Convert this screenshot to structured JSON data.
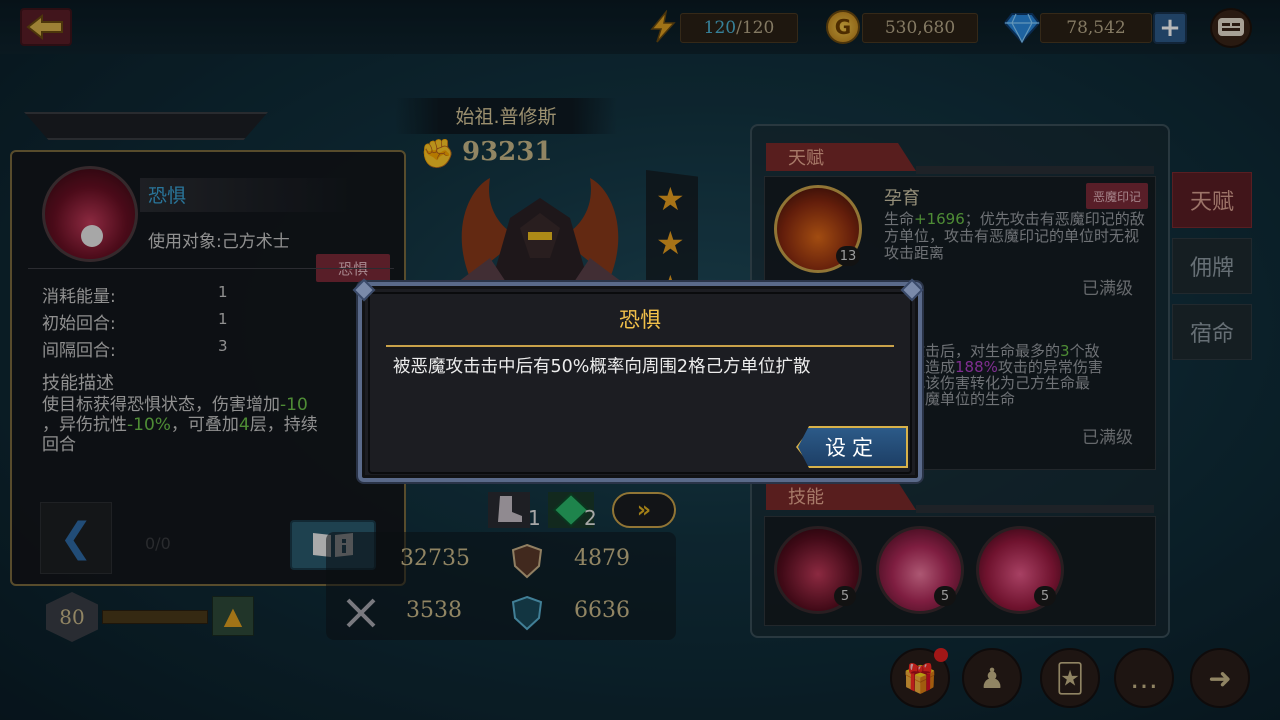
{
  "topbar": {
    "energy_current": "120",
    "energy_max": "/120",
    "gold": "530,680",
    "gems": "78,542",
    "gold_icon_glyph": "G",
    "plus_glyph": "+"
  },
  "skill_panel": {
    "name": "恐惧",
    "target": "使用对象:己方术士",
    "tag": "恐惧",
    "stats": [
      {
        "label": "消耗能量:",
        "value": "1"
      },
      {
        "label": "初始回合:",
        "value": "1"
      },
      {
        "label": "间隔回合:",
        "value": "3"
      }
    ],
    "desc_title": "技能描述",
    "desc_part1": "使目标获得恐惧状态，伤害增加",
    "desc_green1": "-10",
    "desc_part2": "，异伤抗性",
    "desc_green2": "-10%",
    "desc_part3": "，可叠加",
    "desc_green3": "4",
    "desc_part4": "层，持续",
    "desc_part5": "回合",
    "page_counter": "0/0",
    "level": "80"
  },
  "hero": {
    "name": "始祖.普修斯",
    "power": "93231",
    "stars": 3,
    "equip1_count": "1",
    "equip2_count": "2",
    "stats": {
      "attack": "32735",
      "defense": "4879",
      "speed": "3538",
      "resist": "6636"
    }
  },
  "right_panel": {
    "talent_header": "天赋",
    "skill_header": "技能",
    "talent1": {
      "name": "孕育",
      "tag": "恶魔印记",
      "level": "13",
      "desc_pre": "生命",
      "desc_green": "+1696",
      "desc_post": "；优先攻击有恶魔印记的敌方单位，攻击有恶魔印记的单位时无视攻击距离",
      "status": "已满级"
    },
    "talent2": {
      "desc_a": "攻击后，对生命最多的",
      "desc_green": "3",
      "desc_b": "个敌",
      "desc_c": "位造成",
      "desc_purple": "188%",
      "desc_d": "攻击的异常伤害",
      "desc_e": "把该伤害转化为己方生命最",
      "desc_f": "恶魔单位的生命",
      "status": "已满级"
    },
    "skills": [
      {
        "level": "5",
        "color": "#8a1a2e"
      },
      {
        "level": "5",
        "color": "#b02a4a"
      },
      {
        "level": "5",
        "color": "#a01a3a"
      }
    ]
  },
  "side_tabs": [
    {
      "label": "天赋",
      "active": true
    },
    {
      "label": "佣牌",
      "active": false
    },
    {
      "label": "宿命",
      "active": false
    }
  ],
  "modal": {
    "title": "恐惧",
    "text": "被恶魔攻击击中后有50%概率向周围2格己方单位扩散",
    "button": "设定"
  }
}
